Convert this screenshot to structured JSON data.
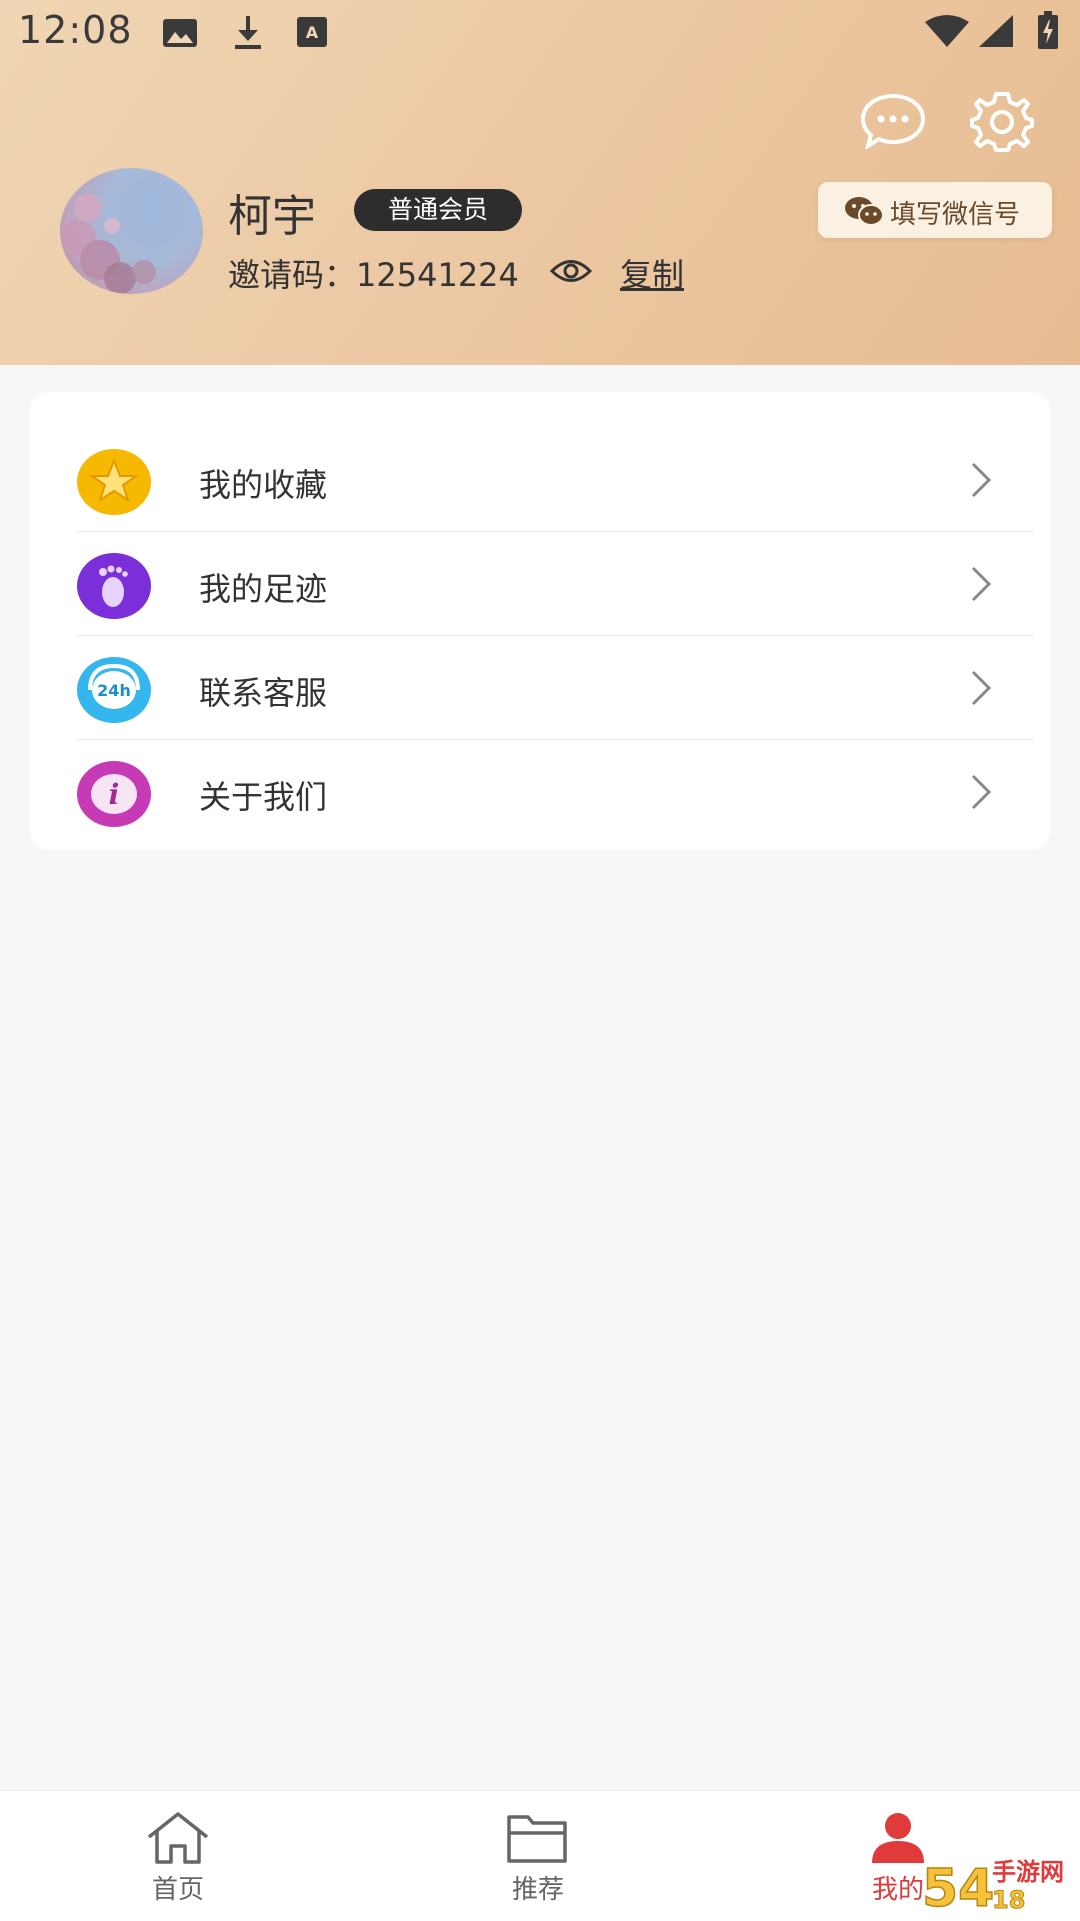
{
  "status_bar": {
    "time": "12:08",
    "left_icons": [
      "image-icon",
      "download-icon",
      "keyboard-a-icon"
    ],
    "right_icons": [
      "wifi-icon",
      "cell-signal-icon",
      "battery-charging-icon"
    ]
  },
  "header": {
    "message_icon": "chat-bubble-icon",
    "settings_icon": "gear-icon",
    "username": "柯宇",
    "member_badge": "普通会员",
    "invite_label": "邀请码：",
    "invite_code": "12541224",
    "copy_label": "复制",
    "wechat_button_label": "填写微信号",
    "colors": {
      "gradient_start": "#f0d6b4",
      "gradient_end": "#e7bd92",
      "badge_bg": "#2d2d2d"
    }
  },
  "menu": {
    "items": [
      {
        "label": "我的收藏",
        "icon": "star-icon",
        "color": "#f6b800"
      },
      {
        "label": "我的足迹",
        "icon": "footprint-icon",
        "color": "#7a2fd8"
      },
      {
        "label": "联系客服",
        "icon": "customer-service-24h-icon",
        "color": "#35b6ee"
      },
      {
        "label": "关于我们",
        "icon": "info-icon",
        "color": "#c63bb5"
      }
    ]
  },
  "tabbar": {
    "active_color": "#e03a3a",
    "tabs": [
      {
        "label": "首页",
        "icon": "home-icon",
        "active": false
      },
      {
        "label": "推荐",
        "icon": "folder-icon",
        "active": false
      },
      {
        "label": "我的",
        "icon": "user-icon",
        "active": true
      }
    ]
  },
  "watermark": {
    "text": "54·18 手游网"
  }
}
